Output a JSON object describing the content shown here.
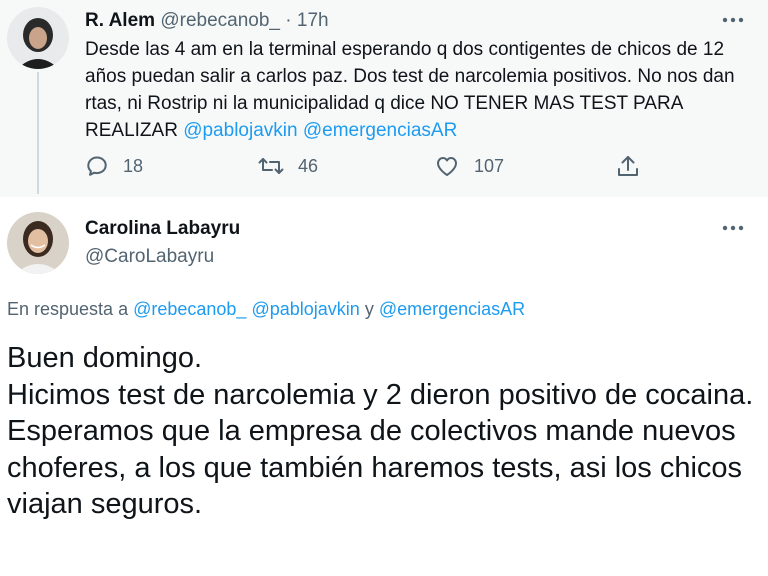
{
  "parent_tweet": {
    "display_name": "R. Alem",
    "handle": "@rebecanob_",
    "separator": "·",
    "time": "17h",
    "text": "Desde las 4 am en la terminal esperando q dos contigentes de chicos de 12 años puedan salir a carlos paz. Dos test de narcolemia positivos. No nos dan rtas, ni Rostrip ni la municipalidad q dice NO TENER MAS TEST PARA REALIZAR",
    "mentions": [
      "@pablojavkin",
      "@emergenciasAR"
    ],
    "actions": {
      "reply_count": "18",
      "retweet_count": "46",
      "like_count": "107"
    }
  },
  "reply_tweet": {
    "display_name": "Carolina Labayru",
    "handle": "@CaroLabayru",
    "in_reply_prefix": "En respuesta a",
    "in_reply_handles": [
      "@rebecanob_",
      "@pablojavkin"
    ],
    "in_reply_and": "y",
    "in_reply_last": "@emergenciasAR",
    "lines": [
      "Buen domingo.",
      "Hicimos test de narcolemia y 2 dieron positivo de cocaina.",
      "Esperamos que la empresa de colectivos mande nuevos choferes, a los que también haremos tests, asi los chicos viajan seguros."
    ]
  },
  "colors": {
    "link": "#1d9bf0",
    "secondary_text": "#536471",
    "parent_bg": "#f7f9f9",
    "thread_line": "#cfd9de"
  },
  "icons": [
    "more-icon",
    "reply-icon",
    "retweet-icon",
    "like-icon",
    "share-icon"
  ]
}
